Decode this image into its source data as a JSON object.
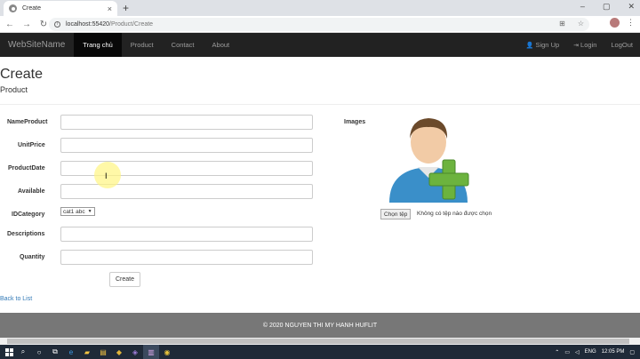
{
  "browser": {
    "tab_title": "Create",
    "tab_close": "×",
    "new_tab": "+",
    "url_host": "localhost:55420",
    "url_path": "/Product/Create",
    "win_min": "–",
    "win_max": "▢",
    "win_close": "✕"
  },
  "navbar": {
    "brand": "WebSiteName",
    "items": [
      {
        "label": "Trang chủ"
      },
      {
        "label": "Product"
      },
      {
        "label": "Contact"
      },
      {
        "label": "About"
      }
    ],
    "signup": "Sign Up",
    "login": "Login",
    "logout": "LogOut"
  },
  "page": {
    "title": "Create",
    "subtitle": "Product"
  },
  "form": {
    "name_label": "NameProduct",
    "price_label": "UnitPrice",
    "date_label": "ProductDate",
    "available_label": "Available",
    "category_label": "IDCategory",
    "category_value": "cat1 abc",
    "desc_label": "Descriptions",
    "qty_label": "Quantity",
    "submit_label": "Create"
  },
  "images": {
    "label": "Images",
    "file_button": "Chọn tệp",
    "file_status": "Không có tệp nào được chọn"
  },
  "back_link": "Back to List",
  "footer": "© 2020 NGUYEN THI MY HANH HUFLIT",
  "taskbar": {
    "lang": "ENG",
    "time": "12:05 PM"
  },
  "colors": {
    "navbar_bg": "#222222",
    "footer_bg": "#777777",
    "link": "#337ab7",
    "plus_green": "#6cb33e"
  }
}
